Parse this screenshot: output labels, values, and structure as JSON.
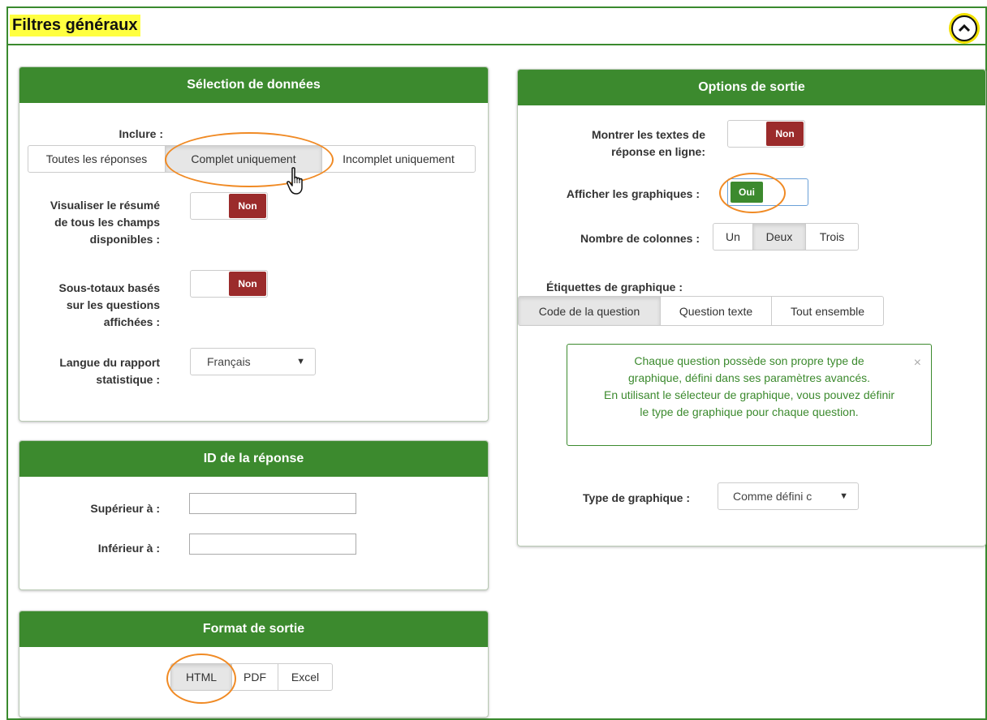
{
  "header": {
    "title": "Filtres généraux",
    "collapse_icon": "chevron-up-icon"
  },
  "data_selection": {
    "title": "Sélection de données",
    "include_label": "Inclure :",
    "include_options": [
      "Toutes les réponses",
      "Complet uniquement",
      "Incomplet uniquement"
    ],
    "include_selected": "Complet uniquement",
    "summary_label_1": "Visualiser le résumé",
    "summary_label_2": "de tous les champs",
    "summary_label_3": "disponibles :",
    "summary_toggle": "Non",
    "subtotals_label_1": "Sous-totaux basés",
    "subtotals_label_2": "sur les questions",
    "subtotals_label_3": "affichées :",
    "subtotals_toggle": "Non",
    "language_label_1": "Langue du rapport",
    "language_label_2": "statistique :",
    "language_value": "Français"
  },
  "response_id": {
    "title": "ID de la réponse",
    "greater_label": "Supérieur à :",
    "greater_value": "",
    "less_label": "Inférieur à :",
    "less_value": ""
  },
  "output_format": {
    "title": "Format de sortie",
    "options": [
      "HTML",
      "PDF",
      "Excel"
    ],
    "selected": "HTML"
  },
  "output_options": {
    "title": "Options de sortie",
    "inline_text_label_1": "Montrer les textes de",
    "inline_text_label_2": "réponse en ligne:",
    "inline_text_toggle": "Non",
    "show_graphs_label": "Afficher les graphiques :",
    "show_graphs_toggle": "Oui",
    "columns_label": "Nombre de colonnes :",
    "columns_options": [
      "Un",
      "Deux",
      "Trois"
    ],
    "columns_selected": "Deux",
    "graph_labels_label": "Étiquettes de graphique :",
    "graph_labels_options": [
      "Code de la question",
      "Question texte",
      "Tout ensemble"
    ],
    "graph_labels_selected": "Code de la question",
    "info_line_1": "Chaque question possède son propre type de",
    "info_line_2": "graphique, défini dans ses paramètres avancés.",
    "info_line_3": "En utilisant le sélecteur de graphique, vous pouvez définir",
    "info_line_4": "le type de graphique pour chaque question.",
    "info_close": "×",
    "graph_type_label": "Type de graphique :",
    "graph_type_value": "Comme défini c"
  },
  "colors": {
    "accent_green": "#3c8a2e",
    "toggle_off": "#9b2b2b",
    "highlight": "#ffff40",
    "annotation": "#f08a24"
  }
}
